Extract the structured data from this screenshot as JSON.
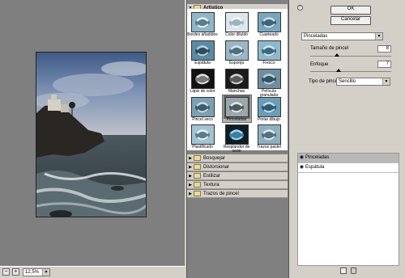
{
  "preview": {
    "zoom": "12,5%",
    "zoom_minus": "−",
    "zoom_plus": "+"
  },
  "gallery": {
    "open_category": "Artístico",
    "filters": [
      "Bordes añadidos",
      "Color diluido",
      "Cuarteado",
      "Espátula",
      "Esponja",
      "Fresco",
      "Lápiz de color",
      "Manchas",
      "Película granulada",
      "Pincel seco",
      "Pinceladas",
      "Pintar dibujo",
      "Plastificado",
      "Resplandor de neón",
      "Trazos pastel"
    ],
    "selected_filter_index": 10,
    "categories": [
      "Bosquejar",
      "Distorsionar",
      "Estilizar",
      "Textura",
      "Trazos de pincel"
    ]
  },
  "settings": {
    "ok_label": "OK",
    "cancel_label": "Cancelar",
    "collapse_icon": "chevron-up-icon",
    "filter_select": "Pinceladas",
    "brush_size_label": "Tamaño de pincel",
    "brush_size_value": "8",
    "brush_size_fraction": 0.33,
    "focus_label": "Enfoque",
    "focus_value": "7",
    "focus_fraction": 0.35,
    "brush_type_label": "Tipo de pincel:",
    "brush_type_value": "Sencillo"
  },
  "layers": {
    "items": [
      "Pinceladas",
      "Espátula"
    ],
    "new_icon": "new-layer-icon",
    "delete_icon": "trash-icon"
  }
}
